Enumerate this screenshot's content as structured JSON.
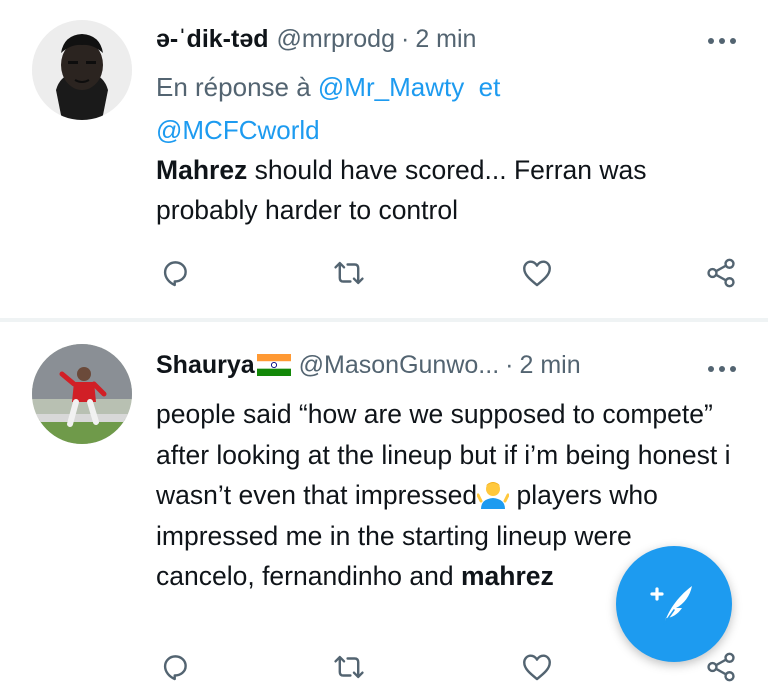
{
  "tweets": [
    {
      "display_name": "ə-ˈdik-təd",
      "handle": "@mrprodg",
      "separator": "·",
      "time": "2 min",
      "reply_prefix": "En réponse à",
      "reply_mention_1": "@Mr_Mawty",
      "reply_and": "et",
      "reply_mention_2": "@MCFCworld",
      "text_bold": "Mahrez",
      "text_rest": " should have scored... Ferran was probably harder to control"
    },
    {
      "display_name": "Shaurya",
      "handle": "@MasonGunwo...",
      "separator": "·",
      "time": "2 min",
      "text_part1": "people said “how are we supposed to compete” after looking at the lineup but if i’m being honest i wasn’t even that impressed",
      "text_part2": " players who impressed me in the starting lineup were cancelo, fernandinho and ",
      "text_bold_end": "mahrez"
    }
  ],
  "icons": {
    "reply": "reply-icon",
    "retweet": "retweet-icon",
    "like": "heart-icon",
    "share": "share-icon",
    "more": "more-icon",
    "compose": "compose-feather-icon",
    "flag": "india-flag-icon",
    "emoji": "person-shrugging-emoji"
  },
  "colors": {
    "accent": "#1d9bf0",
    "secondary_text": "#536471",
    "divider": "#eff3f4"
  }
}
